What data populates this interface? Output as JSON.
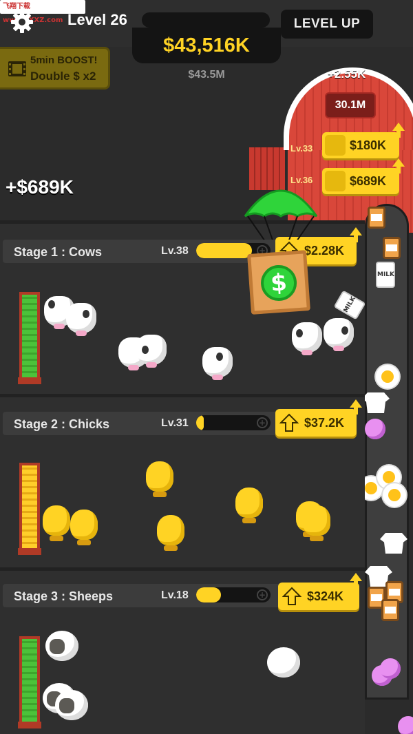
{
  "watermark": "飞翔下载 www.FXXZ.com",
  "hud": {
    "level_label": "Level 26",
    "level_progress": 0.0,
    "level_up_label": "LEVEL UP",
    "money": "$43,516K",
    "money_sub": "$43.5M"
  },
  "boost": {
    "line1": "5min BOOST!",
    "line2": "Double $ x2"
  },
  "income_float": "+$689K",
  "barn": {
    "plus_label": "+2.55K",
    "storage_value": "30.1M",
    "upgrades": [
      {
        "level": "Lv.33",
        "price": "$180K",
        "icon": "shirt-icon"
      },
      {
        "level": "Lv.36",
        "price": "$689K",
        "icon": "truck-icon"
      }
    ]
  },
  "stages": [
    {
      "name": "Stage 1 : Cows",
      "level": "Lv.38",
      "progress": 0.75,
      "price": "$2.28K",
      "animal": "cow",
      "feeder": "green"
    },
    {
      "name": "Stage 2 : Chicks",
      "level": "Lv.31",
      "progress": 0.1,
      "price": "$37.2K",
      "animal": "chick",
      "feeder": "yellow"
    },
    {
      "name": "Stage 3 : Sheeps",
      "level": "Lv.18",
      "progress": 0.33,
      "price": "$324K",
      "animal": "sheep",
      "feeder": "green"
    }
  ],
  "conveyor_items": [
    "jar-icon",
    "milk-icon",
    "egg-icon",
    "shirt-icon",
    "lollipop-icon"
  ],
  "colors": {
    "accent_yellow": "#ffd324",
    "barn_red": "#d9473a",
    "background": "#2b2b2b"
  }
}
